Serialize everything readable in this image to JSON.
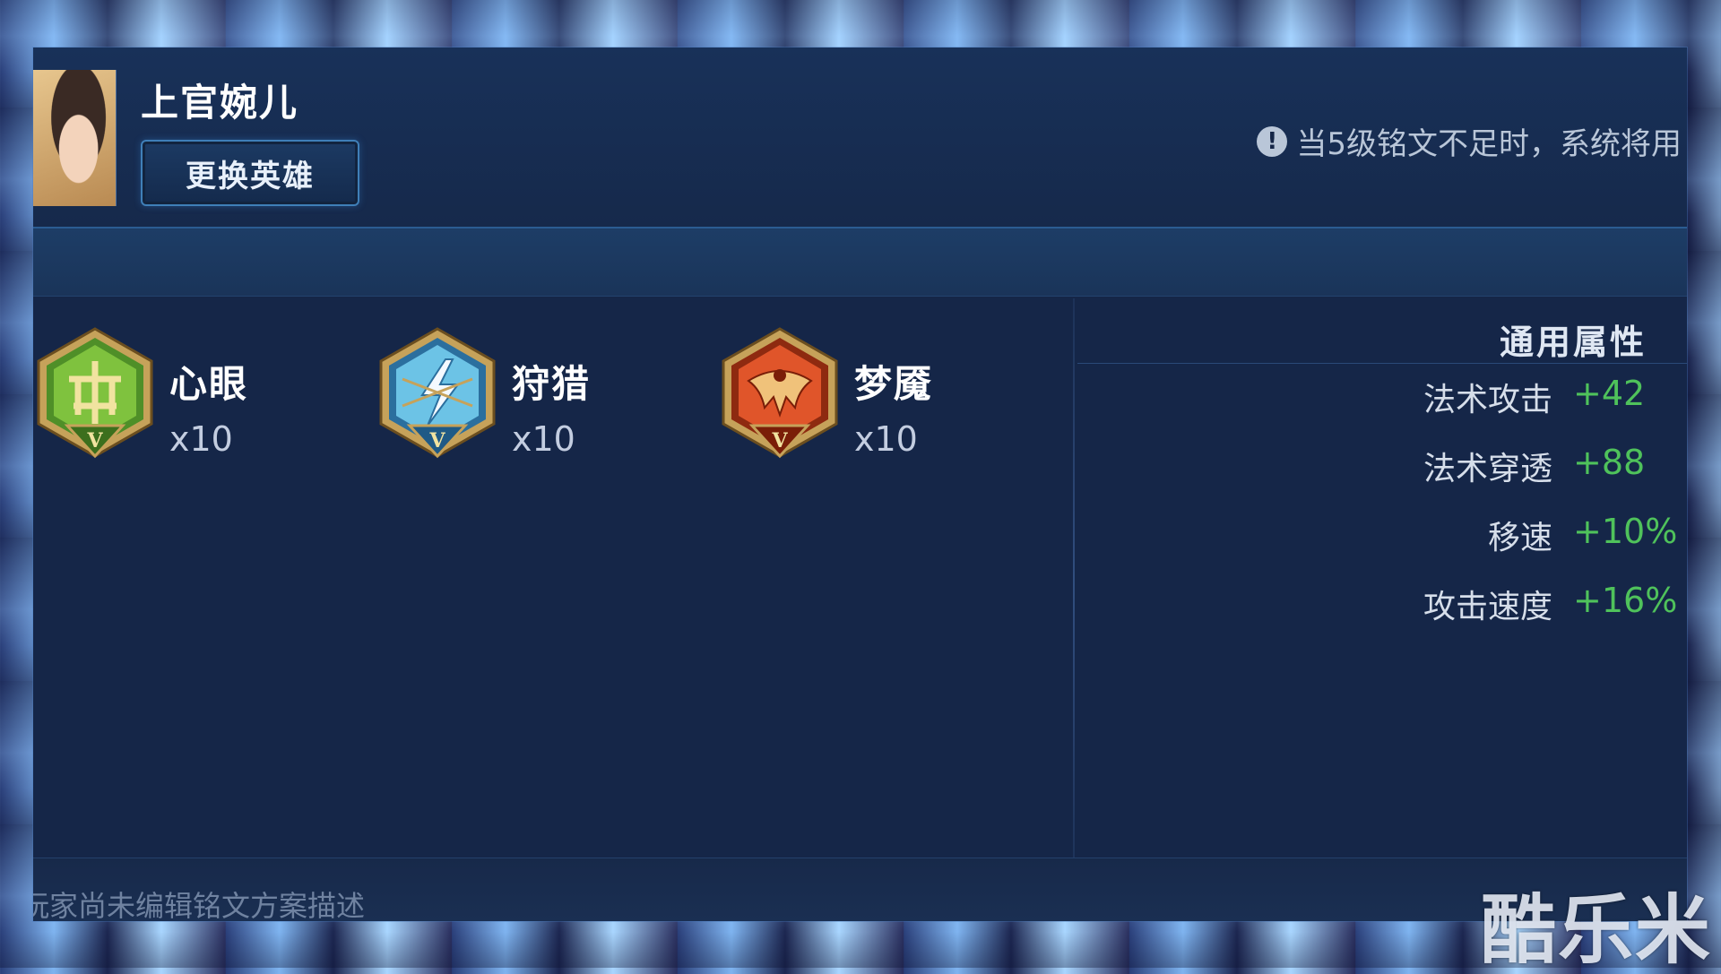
{
  "hero": {
    "name": "上官婉儿",
    "change_button": "更换英雄"
  },
  "notice": {
    "icon": "exclamation-icon",
    "text": "当5级铭文不足时，系统将用"
  },
  "runes": [
    {
      "name": "心眼",
      "count": "x10",
      "tier": "V",
      "color": "#5f9e2f"
    },
    {
      "name": "狩猎",
      "count": "x10",
      "tier": "V",
      "color": "#3a8fc4"
    },
    {
      "name": "梦魇",
      "count": "x10",
      "tier": "V",
      "color": "#c2401e"
    }
  ],
  "stats": {
    "title": "通用属性",
    "rows": [
      {
        "label": "法术攻击",
        "value": "+42"
      },
      {
        "label": "法术穿透",
        "value": "+88"
      },
      {
        "label": "移速",
        "value": "+10%"
      },
      {
        "label": "攻击速度",
        "value": "+16%"
      }
    ]
  },
  "footer": {
    "text": "玩家尚未编辑铭文方案描述"
  },
  "watermark": "酷乐米",
  "colors": {
    "panel": "#152648",
    "stat_value": "#4fc25b",
    "button_border": "#3f7fb8"
  }
}
